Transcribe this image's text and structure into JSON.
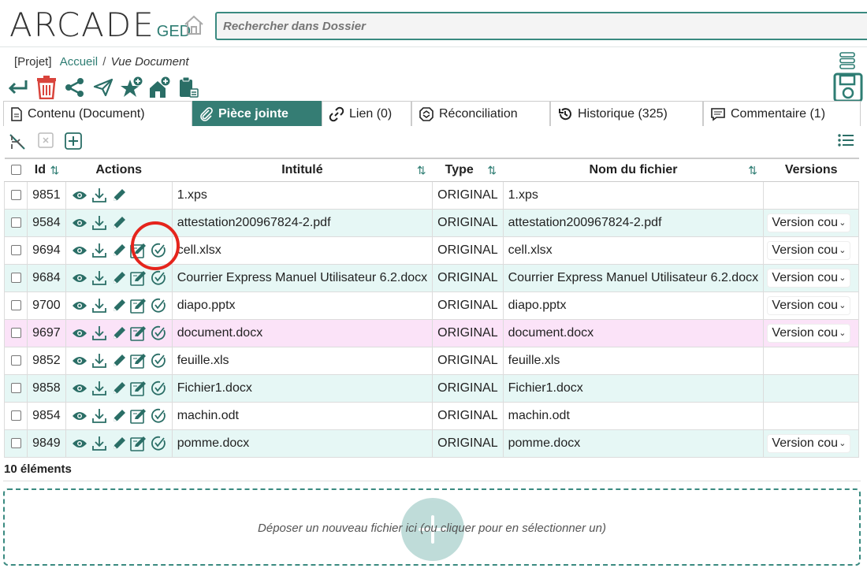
{
  "app": {
    "logo_main": "ARCADE",
    "logo_sub": "GED",
    "search_placeholder": "Rechercher dans Dossier"
  },
  "breadcrumb": {
    "project": "[Projet]",
    "home": "Accueil",
    "separator": "/",
    "current": "Vue Document"
  },
  "toolbar": {
    "icons": [
      "back-icon",
      "trash-icon",
      "share-icon",
      "send-icon",
      "star-add-icon",
      "home-add-icon",
      "clipboard-icon"
    ]
  },
  "tabs": [
    {
      "label": "Contenu (Document)",
      "icon": "document-icon"
    },
    {
      "label": "Pièce jointe",
      "icon": "paperclip-icon",
      "active": true
    },
    {
      "label": "Lien (0)",
      "icon": "link-icon"
    },
    {
      "label": "Réconciliation",
      "icon": "reconcile-icon"
    },
    {
      "label": "Historique (325)",
      "icon": "history-icon"
    },
    {
      "label": "Commentaire (1)",
      "icon": "comment-icon"
    }
  ],
  "table": {
    "headers": {
      "id": "Id",
      "actions": "Actions",
      "intitule": "Intitulé",
      "type": "Type",
      "filename": "Nom du fichier",
      "versions": "Versions"
    },
    "rows": [
      {
        "id": "9851",
        "intitule": "1.xps",
        "type": "ORIGINAL",
        "filename": "1.xps",
        "version": "",
        "extra_icons": false
      },
      {
        "id": "9584",
        "intitule": "attestation200967824-2.pdf",
        "type": "ORIGINAL",
        "filename": "attestation200967824-2.pdf",
        "version": "Version cou",
        "extra_icons": false
      },
      {
        "id": "9694",
        "intitule": "cell.xlsx",
        "type": "ORIGINAL",
        "filename": "cell.xlsx",
        "version": "Version cou",
        "extra_icons": true
      },
      {
        "id": "9684",
        "intitule": "Courrier Express Manuel Utilisateur 6.2.docx",
        "type": "ORIGINAL",
        "filename": "Courrier Express Manuel Utilisateur 6.2.docx",
        "version": "Version cou",
        "extra_icons": true
      },
      {
        "id": "9700",
        "intitule": "diapo.pptx",
        "type": "ORIGINAL",
        "filename": "diapo.pptx",
        "version": "Version cou",
        "extra_icons": true
      },
      {
        "id": "9697",
        "intitule": "document.docx",
        "type": "ORIGINAL",
        "filename": "document.docx",
        "version": "Version cou",
        "extra_icons": true
      },
      {
        "id": "9852",
        "intitule": "feuille.xls",
        "type": "ORIGINAL",
        "filename": "feuille.xls",
        "version": "",
        "extra_icons": true
      },
      {
        "id": "9858",
        "intitule": "Fichier1.docx",
        "type": "ORIGINAL",
        "filename": "Fichier1.docx",
        "version": "",
        "extra_icons": true
      },
      {
        "id": "9854",
        "intitule": "machin.odt",
        "type": "ORIGINAL",
        "filename": "machin.odt",
        "version": "",
        "extra_icons": true
      },
      {
        "id": "9849",
        "intitule": "pomme.docx",
        "type": "ORIGINAL",
        "filename": "pomme.docx",
        "version": "Version cou",
        "extra_icons": true
      }
    ]
  },
  "footer": {
    "count": "10 éléments",
    "dropzone_text": "Déposer un nouveau fichier ici (ou cliquer pour en sélectionner un)"
  },
  "colors": {
    "accent": "#357d74",
    "row_alt": "#e6f7f5",
    "row_highlight": "#fbe3f8",
    "annotation": "#e5241c"
  }
}
